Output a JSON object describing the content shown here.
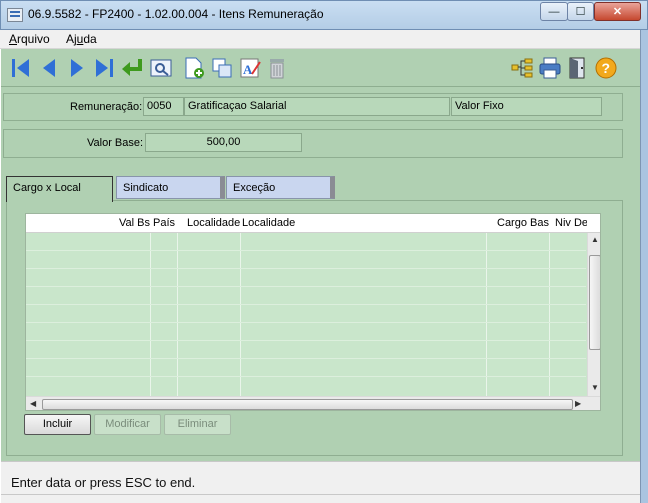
{
  "window": {
    "title": "06.9.5582 - FP2400 - 1.02.00.004 - Itens Remuneração",
    "minimize_glyph": "—",
    "maximize_glyph": "☐",
    "close_glyph": "✕"
  },
  "menu": {
    "arquivo_first": "A",
    "arquivo_rest": "rquivo",
    "ajuda_first": "Aj",
    "ajuda_u": "u",
    "ajuda_rest": "da"
  },
  "toolbar": {
    "icons": [
      "first-record-icon",
      "previous-record-icon",
      "next-record-icon",
      "last-record-icon",
      "return-icon",
      "search-icon",
      "new-document-icon",
      "copy-icon",
      "text-style-icon",
      "trash-icon",
      "tree-icon",
      "print-icon",
      "exit-door-icon",
      "help-icon"
    ]
  },
  "form": {
    "remuneracao_label": "Remuneração:",
    "remuneracao_code": "0050",
    "remuneracao_desc": "Gratificaçao Salarial",
    "remuneracao_tipo": "Valor Fixo",
    "valor_base_label": "Valor Base:",
    "valor_base_value": "500,00"
  },
  "tabs": [
    {
      "label": "Cargo x Local",
      "active": true
    },
    {
      "label": "Sindicato",
      "active": false
    },
    {
      "label": "Exceção",
      "active": false
    }
  ],
  "grid": {
    "columns": [
      "Val Bs País",
      "Localidade",
      "Localidade",
      "Cargo Bas",
      "Niv De"
    ],
    "rows": []
  },
  "buttons": {
    "incluir": "Incluir",
    "modificar": "Modificar",
    "eliminar": "Eliminar"
  },
  "status": {
    "text": "Enter data or press ESC to end."
  },
  "colors": {
    "background": "#b0d0b2",
    "tab_inactive": "#c9d6ef",
    "titlebar": "#c9def2"
  }
}
